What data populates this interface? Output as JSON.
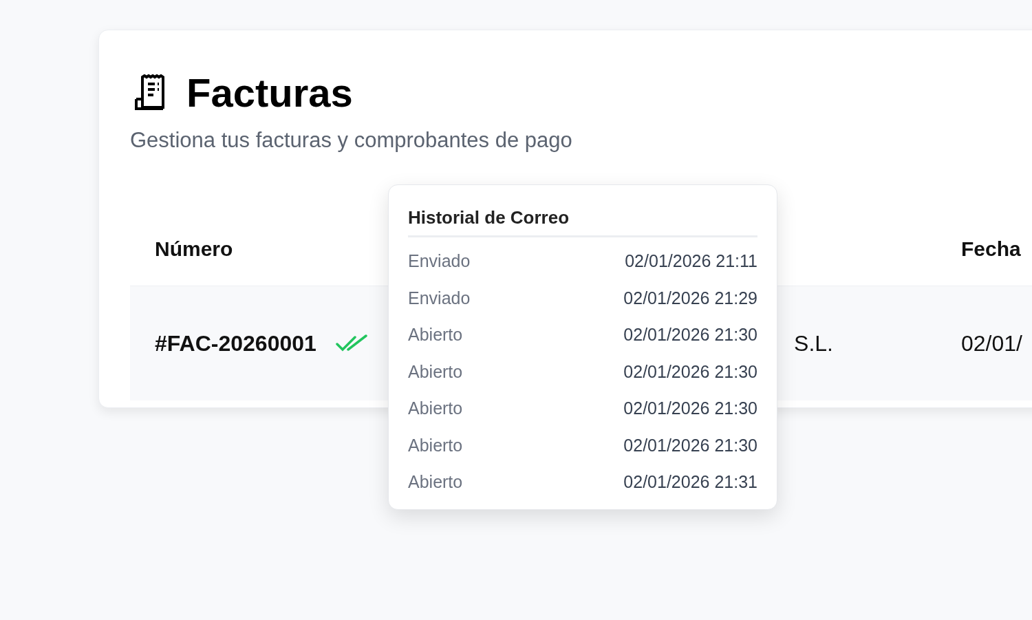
{
  "header": {
    "title": "Facturas",
    "subtitle": "Gestiona tus facturas y comprobantes de pago"
  },
  "table": {
    "columns": [
      "Número",
      null,
      "Fecha"
    ],
    "rows": [
      {
        "cells": [
          "#FAC-20260001",
          "S.L.",
          "02/01/"
        ],
        "email_read": true
      }
    ]
  },
  "email_history": {
    "title": "Historial de Correo",
    "events": [
      {
        "status": "Enviado",
        "time": "02/01/2026 21:11"
      },
      {
        "status": "Enviado",
        "time": "02/01/2026 21:29"
      },
      {
        "status": "Abierto",
        "time": "02/01/2026 21:30"
      },
      {
        "status": "Abierto",
        "time": "02/01/2026 21:30"
      },
      {
        "status": "Abierto",
        "time": "02/01/2026 21:30"
      },
      {
        "status": "Abierto",
        "time": "02/01/2026 21:30"
      },
      {
        "status": "Abierto",
        "time": "02/01/2026 21:31"
      }
    ]
  }
}
